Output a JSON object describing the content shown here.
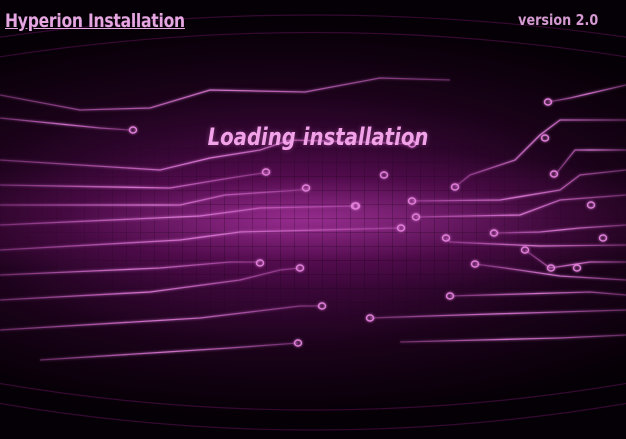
{
  "window": {
    "title": "Hyperion Installation",
    "version": "version 2.0"
  },
  "status": {
    "message": "Loading installation"
  },
  "background": {
    "theme": "circuit-board",
    "accent": "#e070d8",
    "glow": "#c040b8",
    "base": "#2a0428"
  }
}
